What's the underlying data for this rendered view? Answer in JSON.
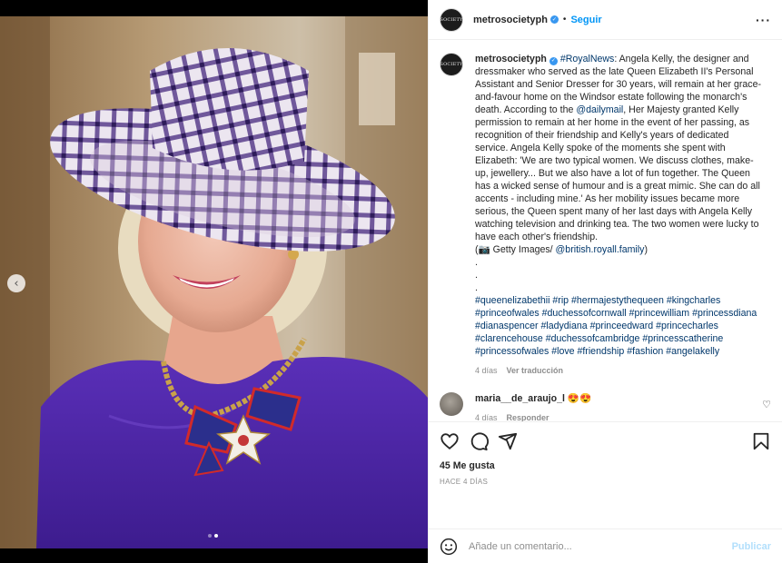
{
  "header": {
    "avatar_text": "SOCIETY",
    "username": "metrosocietyph",
    "separator": "•",
    "follow_label": "Seguir",
    "more_icon": "ellipsis-icon"
  },
  "caption": {
    "username": "metrosocietyph",
    "hashtag_royalnews": "#RoyalNews",
    "text_1": ": Angela Kelly, the designer and dressmaker who served as the late Queen Elizabeth II's Personal Assistant and Senior Dresser for 30 years, will remain at her grace-and-favour home on the Windsor estate following the monarch's death. According to the ",
    "mention_dailymail": "@dailymail",
    "text_2": ", Her Majesty granted Kelly permission to remain at her home in the event of her passing, as recognition of their friendship and Kelly's years of dedicated service. Angela Kelly spoke of the moments she spent with Elizabeth: 'We are two typical women. We discuss clothes, make-up, jewellery... But we also have a lot of fun together. The Queen has a wicked sense of humour and is a great mimic. She can do all accents - including mine.' As her mobility issues became more serious, the Queen spent many of her last days with Angela Kelly watching television and drinking tea. The two women were lucky to have each other's friendship.",
    "credit_prefix": "(📷 Getty Images/ ",
    "mention_credit": "@british.royall.family",
    "credit_suffix": ")",
    "dots": [
      ".",
      ".",
      "."
    ],
    "hashtags": "#queenelizabethii #rip #hermajestythequeen #kingcharles #princeofwales #duchessofcornwall #princewilliam #princessdiana #dianaspencer #ladydiana #princeedward #princecharles #clarencehouse #duchessofcambridge #princesscatherine #princessofwales #love #friendship #fashion #angelakelly",
    "age": "4 días",
    "translate_label": "Ver traducción"
  },
  "comment": {
    "username": "maria__de_araujo_l",
    "text": "😍😍",
    "age": "4 días",
    "reply_label": "Responder"
  },
  "actions": {
    "likes": "45 Me gusta",
    "timestamp": "HACE 4 DÍAS"
  },
  "add_comment": {
    "placeholder": "Añade un comentario...",
    "post_label": "Publicar"
  },
  "carousel": {
    "prev_icon": "chevron-left-icon",
    "total": 2,
    "current": 2
  }
}
